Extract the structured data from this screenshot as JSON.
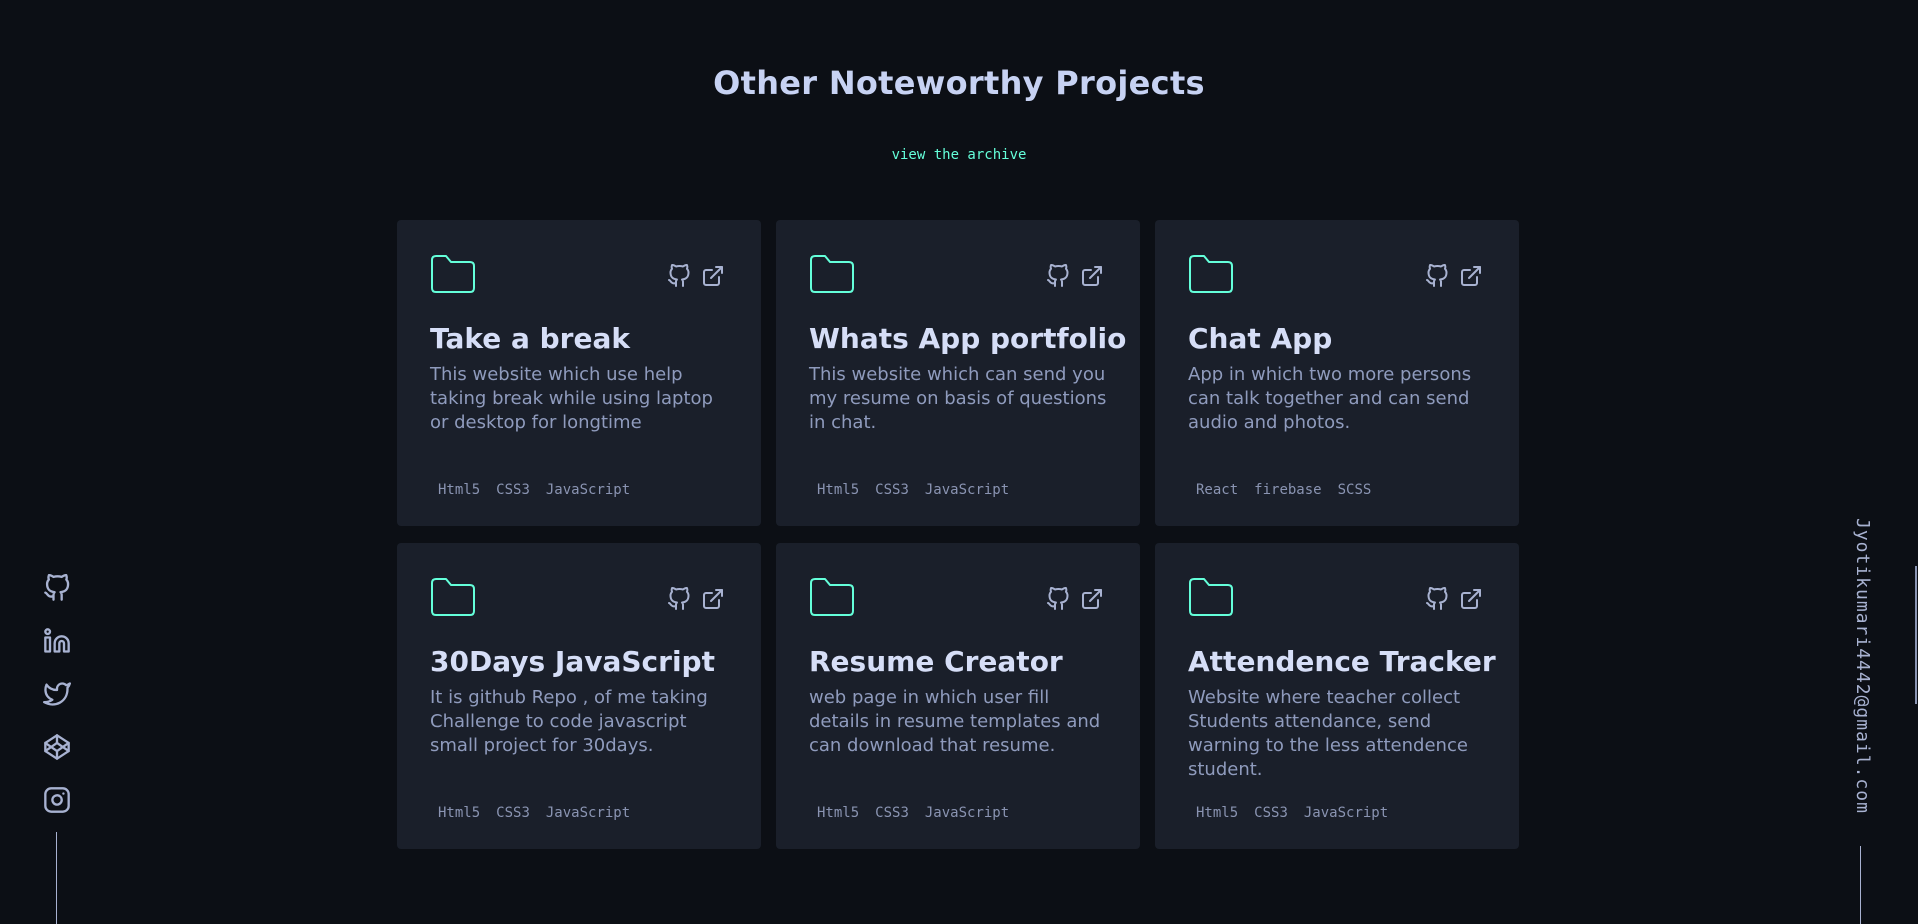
{
  "section": {
    "title": "Other Noteworthy Projects",
    "archive_link": "view the archive"
  },
  "colors": {
    "background": "#0c0f15",
    "card": "#1a1f2a",
    "accent": "#64ffda",
    "title_text": "#ccd6f6",
    "body_text": "#8f9bbd"
  },
  "projects": [
    {
      "title": "Take a break",
      "description": "This website which use help taking break while using laptop or desktop for longtime",
      "tags": [
        "Html5",
        "CSS3",
        "JavaScript"
      ],
      "icons": [
        "folder-icon",
        "github-icon",
        "external-link-icon"
      ]
    },
    {
      "title": "Whats App portfolio",
      "description": "This website which can send you my resume on basis of questions in chat.",
      "tags": [
        "Html5",
        "CSS3",
        "JavaScript"
      ],
      "icons": [
        "folder-icon",
        "github-icon",
        "external-link-icon"
      ]
    },
    {
      "title": "Chat App",
      "description": "App in which two more persons can talk together and can send audio and photos.",
      "tags": [
        "React",
        "firebase",
        "SCSS"
      ],
      "icons": [
        "folder-icon",
        "github-icon",
        "external-link-icon"
      ]
    },
    {
      "title": "30Days JavaScript",
      "description": "It is github Repo , of me taking Challenge to code javascript small project for 30days.",
      "tags": [
        "Html5",
        "CSS3",
        "JavaScript"
      ],
      "icons": [
        "folder-icon",
        "github-icon",
        "external-link-icon"
      ]
    },
    {
      "title": "Resume Creator",
      "description": "web page in which user fill details in resume templates and can download that resume.",
      "tags": [
        "Html5",
        "CSS3",
        "JavaScript"
      ],
      "icons": [
        "folder-icon",
        "github-icon",
        "external-link-icon"
      ]
    },
    {
      "title": "Attendence Tracker",
      "description": "Website where teacher collect Students attendance, send warning to the less attendence student.",
      "tags": [
        "Html5",
        "CSS3",
        "JavaScript"
      ],
      "icons": [
        "folder-icon",
        "github-icon",
        "external-link-icon"
      ]
    }
  ],
  "social": {
    "icons": [
      "github-icon",
      "linkedin-icon",
      "twitter-icon",
      "codepen-icon",
      "instagram-icon"
    ]
  },
  "email": "Jyotikumari4442@gmail.com"
}
